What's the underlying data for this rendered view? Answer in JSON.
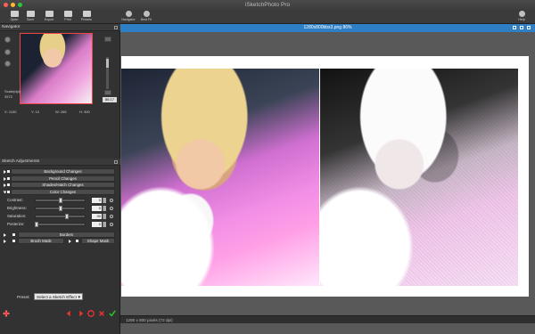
{
  "window": {
    "title": "iSketchPhoto Pro"
  },
  "toolbar": {
    "left": [
      {
        "label": "Open",
        "icon": "open-icon"
      },
      {
        "label": "Save",
        "icon": "save-icon"
      },
      {
        "label": "Export",
        "icon": "export-icon"
      },
      {
        "label": "Print",
        "icon": "print-icon"
      },
      {
        "label": "Presets",
        "icon": "presets-icon"
      }
    ],
    "center": [
      {
        "label": "Navigator",
        "icon": "navigator-icon"
      },
      {
        "label": "Best Fit",
        "icon": "best-fit-icon"
      }
    ],
    "right": [
      {
        "label": "Help",
        "icon": "help-icon"
      }
    ]
  },
  "navigator": {
    "title": "Navigator",
    "scale_label": "Scale(dpi)",
    "scale_value": "3572",
    "zoom_value": "86.17",
    "coords": [
      "X: 1130",
      "Y: 10",
      "W: 265",
      "H: 300"
    ]
  },
  "sketch": {
    "title": "Sketch Adjustments",
    "sections": [
      "Background Changes",
      "Pencil Changes",
      "Shades/Hatch Changes",
      "Color Changes"
    ],
    "sliders": [
      {
        "label": "Contrast:",
        "value": "0",
        "fraction": 0.5
      },
      {
        "label": "Brightness:",
        "value": "0",
        "fraction": 0.5
      },
      {
        "label": "Saturation:",
        "value": "30",
        "fraction": 0.65
      },
      {
        "label": "Posterize:",
        "value": "0",
        "fraction": 0.0
      }
    ],
    "borders_label": "Borders",
    "brush_mask_label": "Brush Mask",
    "shape_mask_label": "Shape Mask",
    "preset_label": "Preset:",
    "preset_value": "Select a Sketch Effect"
  },
  "image_window": {
    "title": "1280x800bbs3.png 86%",
    "status": "1280 x 800 pixels (72 dpi)"
  },
  "colors": {
    "accent": "#2f7fc6",
    "toolbar_bg": "#3b3b3b",
    "panel_bg": "#323232",
    "canvas_bg": "#595959"
  }
}
